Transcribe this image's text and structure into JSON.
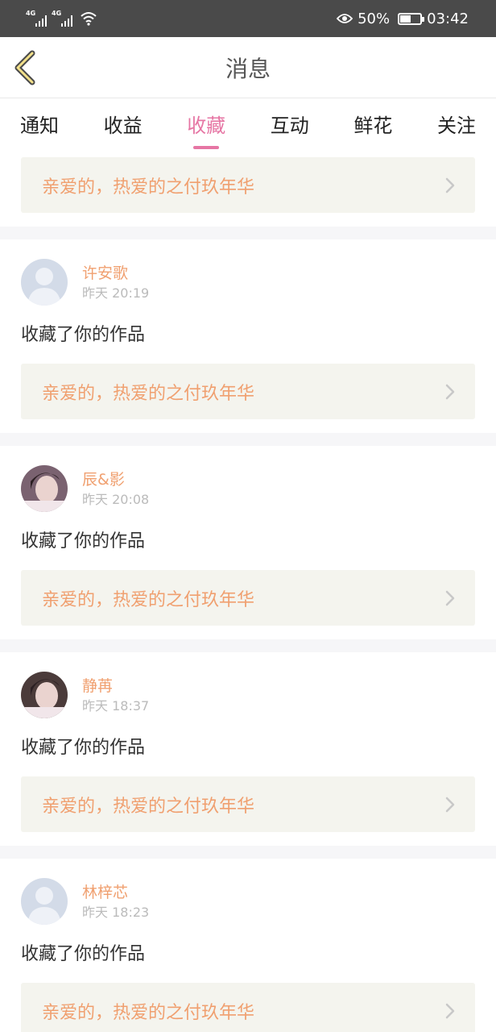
{
  "status_bar": {
    "network1": "4G",
    "network2": "4G",
    "battery_percent": "50%",
    "battery_level": 0.5,
    "time": "03:42"
  },
  "nav": {
    "title": "消息",
    "back_icon": "chevron-left-icon"
  },
  "tabs": [
    {
      "label": "通知",
      "active": false
    },
    {
      "label": "收益",
      "active": false
    },
    {
      "label": "收藏",
      "active": true
    },
    {
      "label": "互动",
      "active": false
    },
    {
      "label": "鲜花",
      "active": false
    },
    {
      "label": "关注",
      "active": false
    }
  ],
  "colors": {
    "accent": "#e676a4",
    "username": "#f0a070",
    "work_bg": "#f4f4ee"
  },
  "first_item": {
    "work_title": "亲爱的，热爱的之付玖年华"
  },
  "messages": [
    {
      "username": "许安歌",
      "time": "昨天 20:19",
      "text": "收藏了你的作品",
      "work_title": "亲爱的，热爱的之付玖年华",
      "avatar": "default-avatar"
    },
    {
      "username": "辰&影",
      "time": "昨天 20:08",
      "text": "收藏了你的作品",
      "work_title": "亲爱的，热爱的之付玖年华",
      "avatar": "photo-avatar"
    },
    {
      "username": "静苒",
      "time": "昨天 18:37",
      "text": "收藏了你的作品",
      "work_title": "亲爱的，热爱的之付玖年华",
      "avatar": "photo-avatar"
    },
    {
      "username": "林梓芯",
      "time": "昨天 18:23",
      "text": "收藏了你的作品",
      "work_title": "亲爱的，热爱的之付玖年华",
      "avatar": "default-avatar"
    }
  ]
}
